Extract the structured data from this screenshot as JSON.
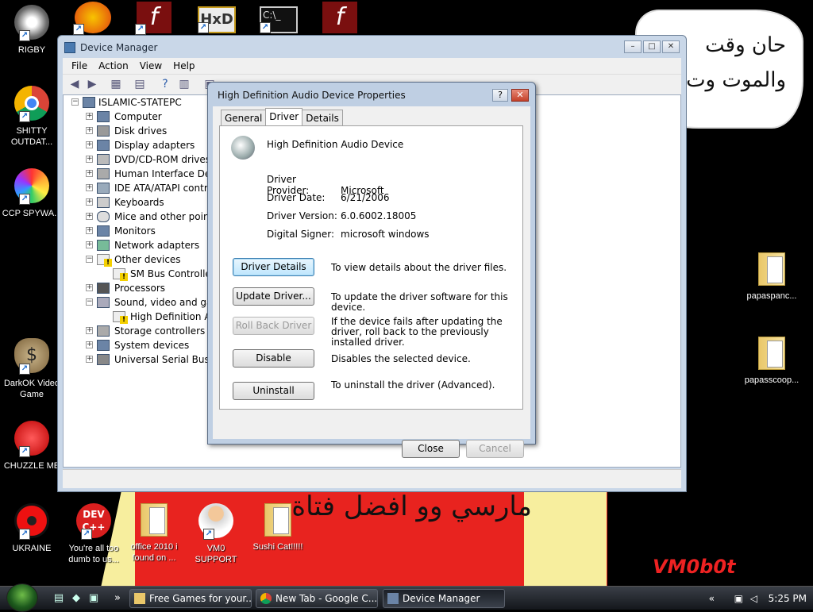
{
  "desktop": {
    "icons": [
      {
        "label": "RIGBY",
        "icon": "raccoon-icon"
      },
      {
        "label": "SHITTY OUTDAT...",
        "icon": "chrome-icon"
      },
      {
        "label": "CCP SPYWA...",
        "icon": "pinwheel-icon"
      },
      {
        "label": "DarkOK Video Game",
        "icon": "money-bag-icon"
      },
      {
        "label": "CHUZZLE ME",
        "icon": "chuzzle-icon"
      },
      {
        "label": "UKRAINE",
        "icon": "radiation-icon"
      },
      {
        "label": "You're all too dumb to us...",
        "icon": "dev-cpp-icon"
      },
      {
        "label": "office 2010 i found on ...",
        "icon": "folder-icon"
      },
      {
        "label": "VM0 SUPPORT",
        "icon": "support-person-icon"
      },
      {
        "label": "Sushi Cat!!!!!",
        "icon": "folder-icon"
      },
      {
        "label": "papaspanc...",
        "icon": "folder-icon"
      },
      {
        "label": "papasscoop...",
        "icon": "folder-icon"
      }
    ],
    "top_icons": [
      "pizza-p-icon",
      "flash-icon",
      "hxd-icon",
      "terminal-icon",
      "flash-icon"
    ],
    "wallpaper": {
      "speech_text": "حان وقت والموت وت",
      "banner_text": "مارسي وو افضل فتاة",
      "watermark": "VM0b0t",
      "banner_color": "#e8231f",
      "banner_accent": "#f7ee9e"
    }
  },
  "device_manager": {
    "title": "Device Manager",
    "menu": [
      "File",
      "Action",
      "View",
      "Help"
    ],
    "tree": {
      "root": "ISLAMIC-STATEPC",
      "items": [
        {
          "label": "Computer",
          "expanded": false
        },
        {
          "label": "Disk drives",
          "expanded": false
        },
        {
          "label": "Display adapters",
          "expanded": false
        },
        {
          "label": "DVD/CD-ROM drives",
          "expanded": false
        },
        {
          "label": "Human Interface Devic",
          "expanded": false
        },
        {
          "label": "IDE ATA/ATAPI contro",
          "expanded": false
        },
        {
          "label": "Keyboards",
          "expanded": false
        },
        {
          "label": "Mice and other pointin",
          "expanded": false
        },
        {
          "label": "Monitors",
          "expanded": false
        },
        {
          "label": "Network adapters",
          "expanded": false
        },
        {
          "label": "Other devices",
          "expanded": true
        },
        {
          "label": "SM Bus Controller",
          "child": true,
          "warning": true
        },
        {
          "label": "Processors",
          "expanded": false
        },
        {
          "label": "Sound, video and gam",
          "expanded": true
        },
        {
          "label": "High Definition Au",
          "child": true,
          "warning": true
        },
        {
          "label": "Storage controllers",
          "expanded": false
        },
        {
          "label": "System devices",
          "expanded": false
        },
        {
          "label": "Universal Serial Bus co",
          "expanded": false
        }
      ]
    }
  },
  "properties_dialog": {
    "title": "High Definition Audio Device Properties",
    "help_glyph": "?",
    "close_glyph": "✕",
    "tabs": [
      "General",
      "Driver",
      "Details"
    ],
    "active_tab": "Driver",
    "device_name": "High Definition Audio Device",
    "properties": [
      {
        "key": "Driver Provider:",
        "value": "Microsoft"
      },
      {
        "key": "Driver Date:",
        "value": "6/21/2006"
      },
      {
        "key": "Driver Version:",
        "value": "6.0.6002.18005"
      },
      {
        "key": "Digital Signer:",
        "value": "microsoft windows"
      }
    ],
    "actions": [
      {
        "label": "Driver Details",
        "desc": "To view details about the driver files.",
        "enabled": true
      },
      {
        "label": "Update Driver...",
        "desc": "To update the driver software for this device.",
        "enabled": true
      },
      {
        "label": "Roll Back Driver",
        "desc": "If the device fails after updating the driver, roll back to the previously installed driver.",
        "enabled": false
      },
      {
        "label": "Disable",
        "desc": "Disables the selected device.",
        "enabled": true
      },
      {
        "label": "Uninstall",
        "desc": "To uninstall the driver (Advanced).",
        "enabled": true
      }
    ],
    "footer": {
      "close": "Close",
      "cancel": "Cancel"
    }
  },
  "taskbar": {
    "tasks": [
      {
        "label": "Free Games for your...",
        "icon": "folder-icon"
      },
      {
        "label": "New Tab - Google C...",
        "icon": "chrome-icon"
      },
      {
        "label": "Device Manager",
        "icon": "device-manager-icon"
      }
    ],
    "clock": "5:25 PM",
    "chevron": "«",
    "quicklaunch_more": "»"
  }
}
